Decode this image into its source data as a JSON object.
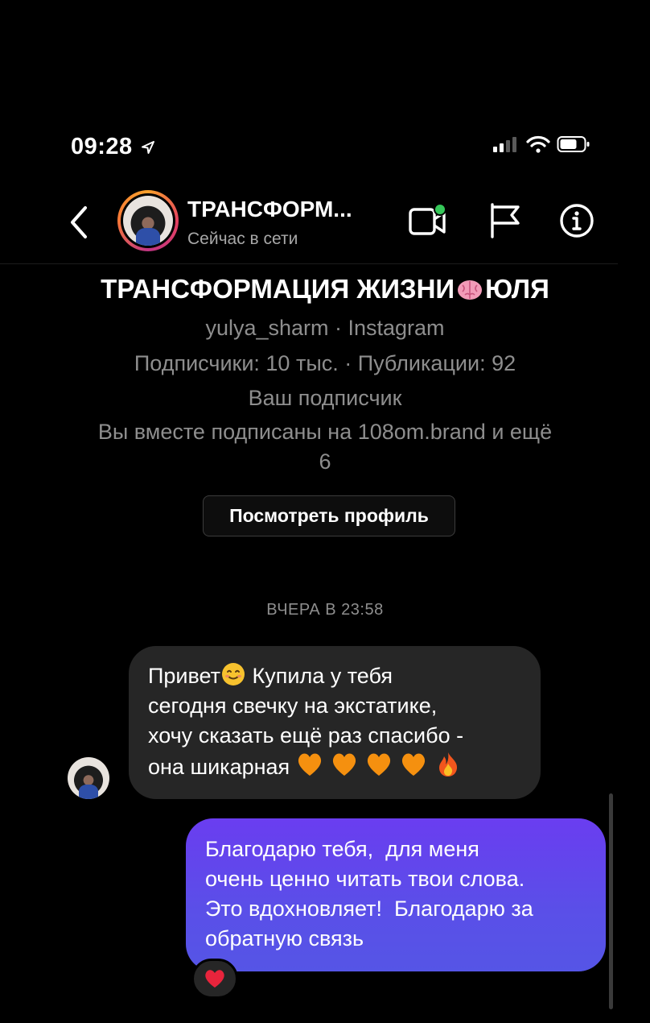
{
  "status_bar": {
    "time": "09:28",
    "location_glyph": "➤"
  },
  "header": {
    "back_icon": "chevron-left-icon",
    "name": "ТРАНСФОРМ...",
    "status": "Сейчас в сети",
    "actions": [
      "video-call-icon",
      "flag-icon",
      "info-icon"
    ]
  },
  "profile": {
    "title_part1": "ТРАНСФОРМАЦИЯ ЖИЗНИ",
    "title_part2": "ЮЛЯ",
    "handle": "yulya_sharm · Instagram",
    "stats": "Подписчики: 10 тыс. · Публикации: 92",
    "follow_status": "Ваш подписчик",
    "mutual_line1": "Вы вместе подписаны на 108om.brand и ещё",
    "mutual_line2": "6",
    "view_profile_label": "Посмотреть профиль"
  },
  "conversation": {
    "date_separator": "ВЧЕРА В 23:58",
    "incoming": {
      "line1_a": "Привет",
      "line1_b": " Купила у тебя",
      "line2": "сегодня свечку на экстатике,",
      "line3": "хочу сказать ещё раз спасибо -",
      "line4": "она шикарная "
    },
    "outgoing": {
      "text": "Благодарю тебя,  для меня\nочень ценно читать твои слова.\nЭто вдохновляет!  Благодарю за\nобратную связь"
    },
    "reaction": "heart-icon"
  },
  "colors": {
    "background": "#000000",
    "incoming_bubble": "#262626",
    "outgoing_bubble": "#5a4fe8",
    "secondary_text": "#8e8e8e",
    "online_dot": "#35c759"
  }
}
